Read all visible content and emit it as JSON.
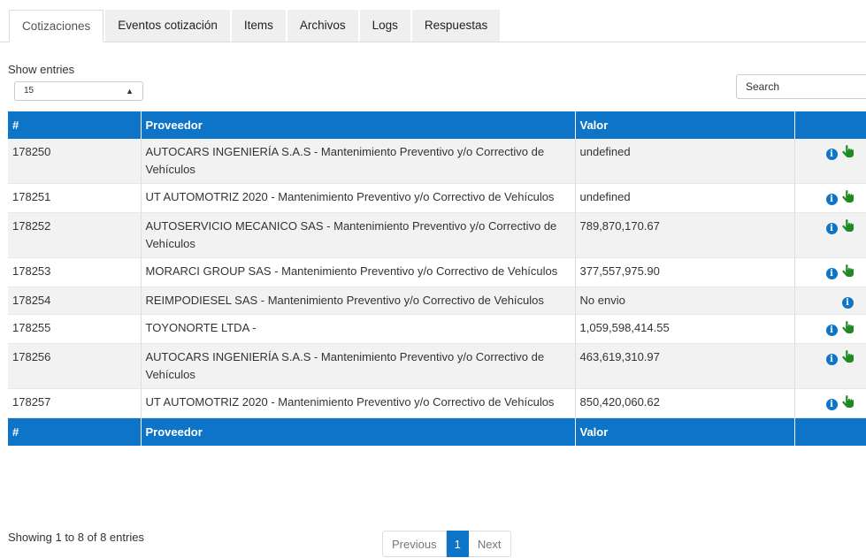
{
  "tabs": [
    {
      "label": "Cotizaciones"
    },
    {
      "label": "Eventos cotización"
    },
    {
      "label": "Items"
    },
    {
      "label": "Archivos"
    },
    {
      "label": "Logs"
    },
    {
      "label": "Respuestas"
    }
  ],
  "length_menu": {
    "label": "Show entries",
    "value": "15"
  },
  "search": {
    "placeholder": "Search"
  },
  "table": {
    "headers": [
      "#",
      "Proveedor",
      "Valor",
      ""
    ],
    "rows": [
      {
        "id": "178250",
        "proveedor": "AUTOCARS INGENIERÍA S.A.S - Mantenimiento Preventivo y/o Correctivo de Vehículos",
        "valor": "undefined",
        "actions": [
          "info-icon",
          "hand-pointer-icon"
        ]
      },
      {
        "id": "178251",
        "proveedor": "UT AUTOMOTRIZ 2020 - Mantenimiento Preventivo y/o Correctivo de Vehículos",
        "valor": "undefined",
        "actions": [
          "info-icon",
          "hand-pointer-icon"
        ]
      },
      {
        "id": "178252",
        "proveedor": "AUTOSERVICIO MECANICO SAS - Mantenimiento Preventivo y/o Correctivo de Vehículos",
        "valor": "789,870,170.67",
        "actions": [
          "info-icon",
          "hand-pointer-icon"
        ]
      },
      {
        "id": "178253",
        "proveedor": "MORARCI GROUP SAS - Mantenimiento Preventivo y/o Correctivo de Vehículos",
        "valor": "377,557,975.90",
        "actions": [
          "info-icon",
          "hand-pointer-icon"
        ]
      },
      {
        "id": "178254",
        "proveedor": "REIMPODIESEL SAS  - Mantenimiento Preventivo y/o Correctivo de Vehículos",
        "valor": "No envio",
        "actions": [
          "info-icon"
        ]
      },
      {
        "id": "178255",
        "proveedor": "TOYONORTE LTDA -",
        "valor": "1,059,598,414.55",
        "actions": [
          "info-icon",
          "hand-pointer-icon"
        ]
      },
      {
        "id": "178256",
        "proveedor": "AUTOCARS INGENIERÍA S.A.S - Mantenimiento Preventivo y/o Correctivo de Vehículos",
        "valor": "463,619,310.97",
        "actions": [
          "info-icon",
          "hand-pointer-icon"
        ]
      },
      {
        "id": "178257",
        "proveedor": "UT AUTOMOTRIZ 2020 - Mantenimiento Preventivo y/o Correctivo de Vehículos",
        "valor": "850,420,060.62",
        "actions": [
          "info-icon",
          "hand-pointer-icon"
        ]
      }
    ]
  },
  "footer": {
    "info": "Showing 1 to 8 of 8 entries",
    "previous": "Previous",
    "current_page": "1",
    "next": "Next"
  },
  "icons": {
    "info": "i"
  },
  "colors": {
    "primary": "#0d74c8",
    "action_green": "#1e8a22"
  }
}
